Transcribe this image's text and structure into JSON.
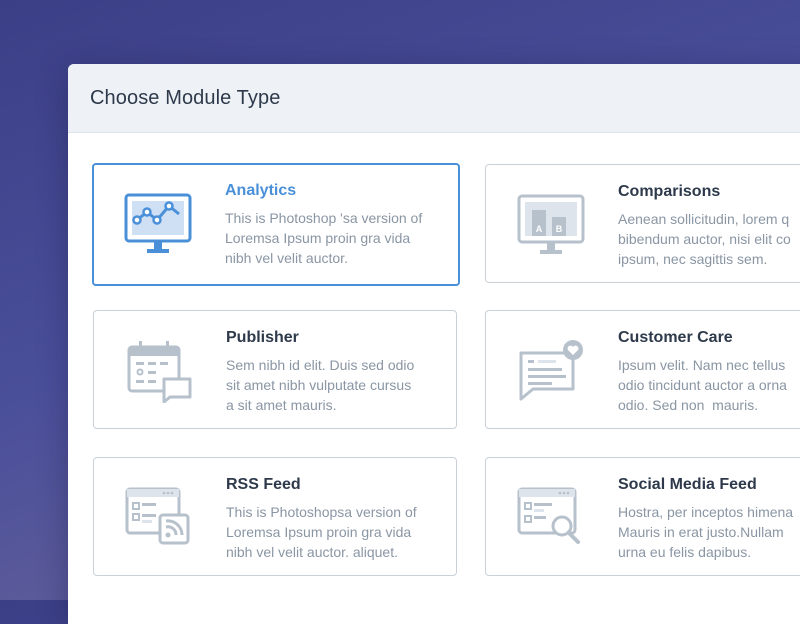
{
  "dialog": {
    "title": "Choose Module Type"
  },
  "colors": {
    "accent": "#4a90d9",
    "icon_gray": "#b7c1cc",
    "icon_fill": "#dde4ec"
  },
  "modules": [
    {
      "title": "Analytics",
      "description": "This is Photoshop 'sa version of\nLoremsa Ipsum proin gra vida\nnibh vel velit auctor.",
      "icon": "monitor-chart-icon",
      "selected": true
    },
    {
      "title": "Comparisons",
      "description": "Aenean sollicitudin, lorem q\nbibendum auctor, nisi elit co\nipsum, nec sagittis sem.",
      "icon": "monitor-ab-test-icon",
      "selected": false
    },
    {
      "title": "Publisher",
      "description": "Sem nibh id elit. Duis sed odio\nsit amet nibh vulputate cursus\na sit amet mauris.",
      "icon": "calendar-comment-icon",
      "selected": false
    },
    {
      "title": "Customer Care",
      "description": "Ipsum velit. Nam nec tellus\nodio tincidunt auctor a orna\nodio. Sed non  mauris.",
      "icon": "chat-heart-icon",
      "selected": false
    },
    {
      "title": "RSS Feed",
      "description": "This is Photoshopsa version of\nLoremsa Ipsum proin gra vida\nnibh vel velit auctor. aliquet.",
      "icon": "browser-rss-icon",
      "selected": false
    },
    {
      "title": "Social Media Feed",
      "description": "Hostra, per inceptos himena\nMauris in erat justo.Nullam\nurna eu felis dapibus.",
      "icon": "browser-search-icon",
      "selected": false
    }
  ]
}
